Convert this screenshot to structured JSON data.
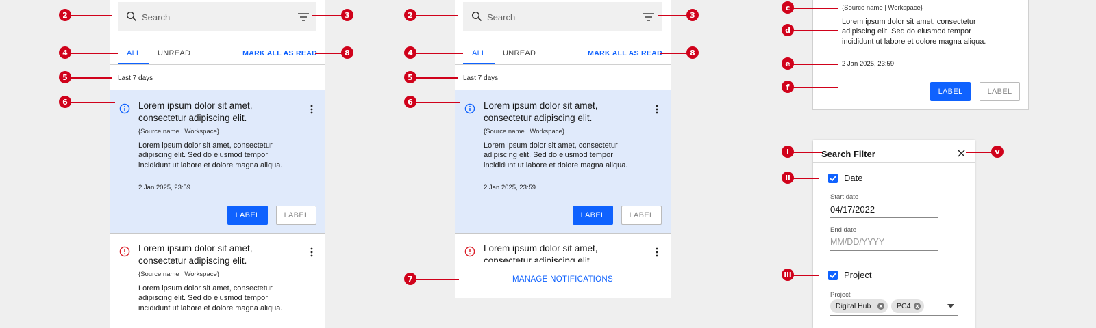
{
  "search": {
    "placeholder": "Search"
  },
  "tabs": {
    "all": "ALL",
    "unread": "UNREAD",
    "mark_all_read": "MARK ALL AS READ"
  },
  "period_label": "Last 7 days",
  "notifications": [
    {
      "type": "info",
      "title": "Lorem ipsum dolor sit amet, consectetur adipiscing elit.",
      "source": "{Source name | Workspace}",
      "body": "Lorem ipsum dolor sit amet, consectetur adipiscing elit. Sed do eiusmod tempor incididunt ut labore et dolore magna aliqua.",
      "date": "2 Jan 2025, 23:59",
      "primary_label": "LABEL",
      "secondary_label": "LABEL"
    },
    {
      "type": "error",
      "title": "Lorem ipsum dolor sit amet, consectetur adipiscing elit.",
      "source": "{Source name | Workspace}",
      "body": "Lorem ipsum dolor sit amet, consectetur adipiscing elit. Sed do eiusmod tempor incididunt ut labore et dolore magna aliqua."
    }
  ],
  "manage_label": "MANAGE NOTIFICATIONS",
  "detail": {
    "source": "{Source name | Workspace}",
    "body": "Lorem ipsum dolor sit amet, consectetur adipiscing elit. Sed do eiusmod tempor incididunt ut labore et dolore magna aliqua.",
    "date": "2 Jan 2025, 23:59",
    "primary_label": "LABEL",
    "secondary_label": "LABEL"
  },
  "filter": {
    "title": "Search Filter",
    "date_label": "Date",
    "start_date_label": "Start date",
    "start_date_value": "04/17/2022",
    "end_date_label": "End date",
    "end_date_placeholder": "MM/DD/YYYY",
    "project_label": "Project",
    "project_field_label": "Project",
    "tags": [
      "Digital Hub",
      "PC4"
    ]
  },
  "callouts": {
    "numbers": [
      "2",
      "3",
      "4",
      "8",
      "5",
      "6",
      "7"
    ],
    "letters": [
      "c",
      "d",
      "e",
      "f"
    ],
    "roman": [
      "i",
      "ii",
      "iii",
      "v"
    ]
  },
  "colors": {
    "accent": "#0f62fe",
    "callout": "#d0021b",
    "active_bg": "#e0eafb",
    "error": "#da1e28"
  }
}
